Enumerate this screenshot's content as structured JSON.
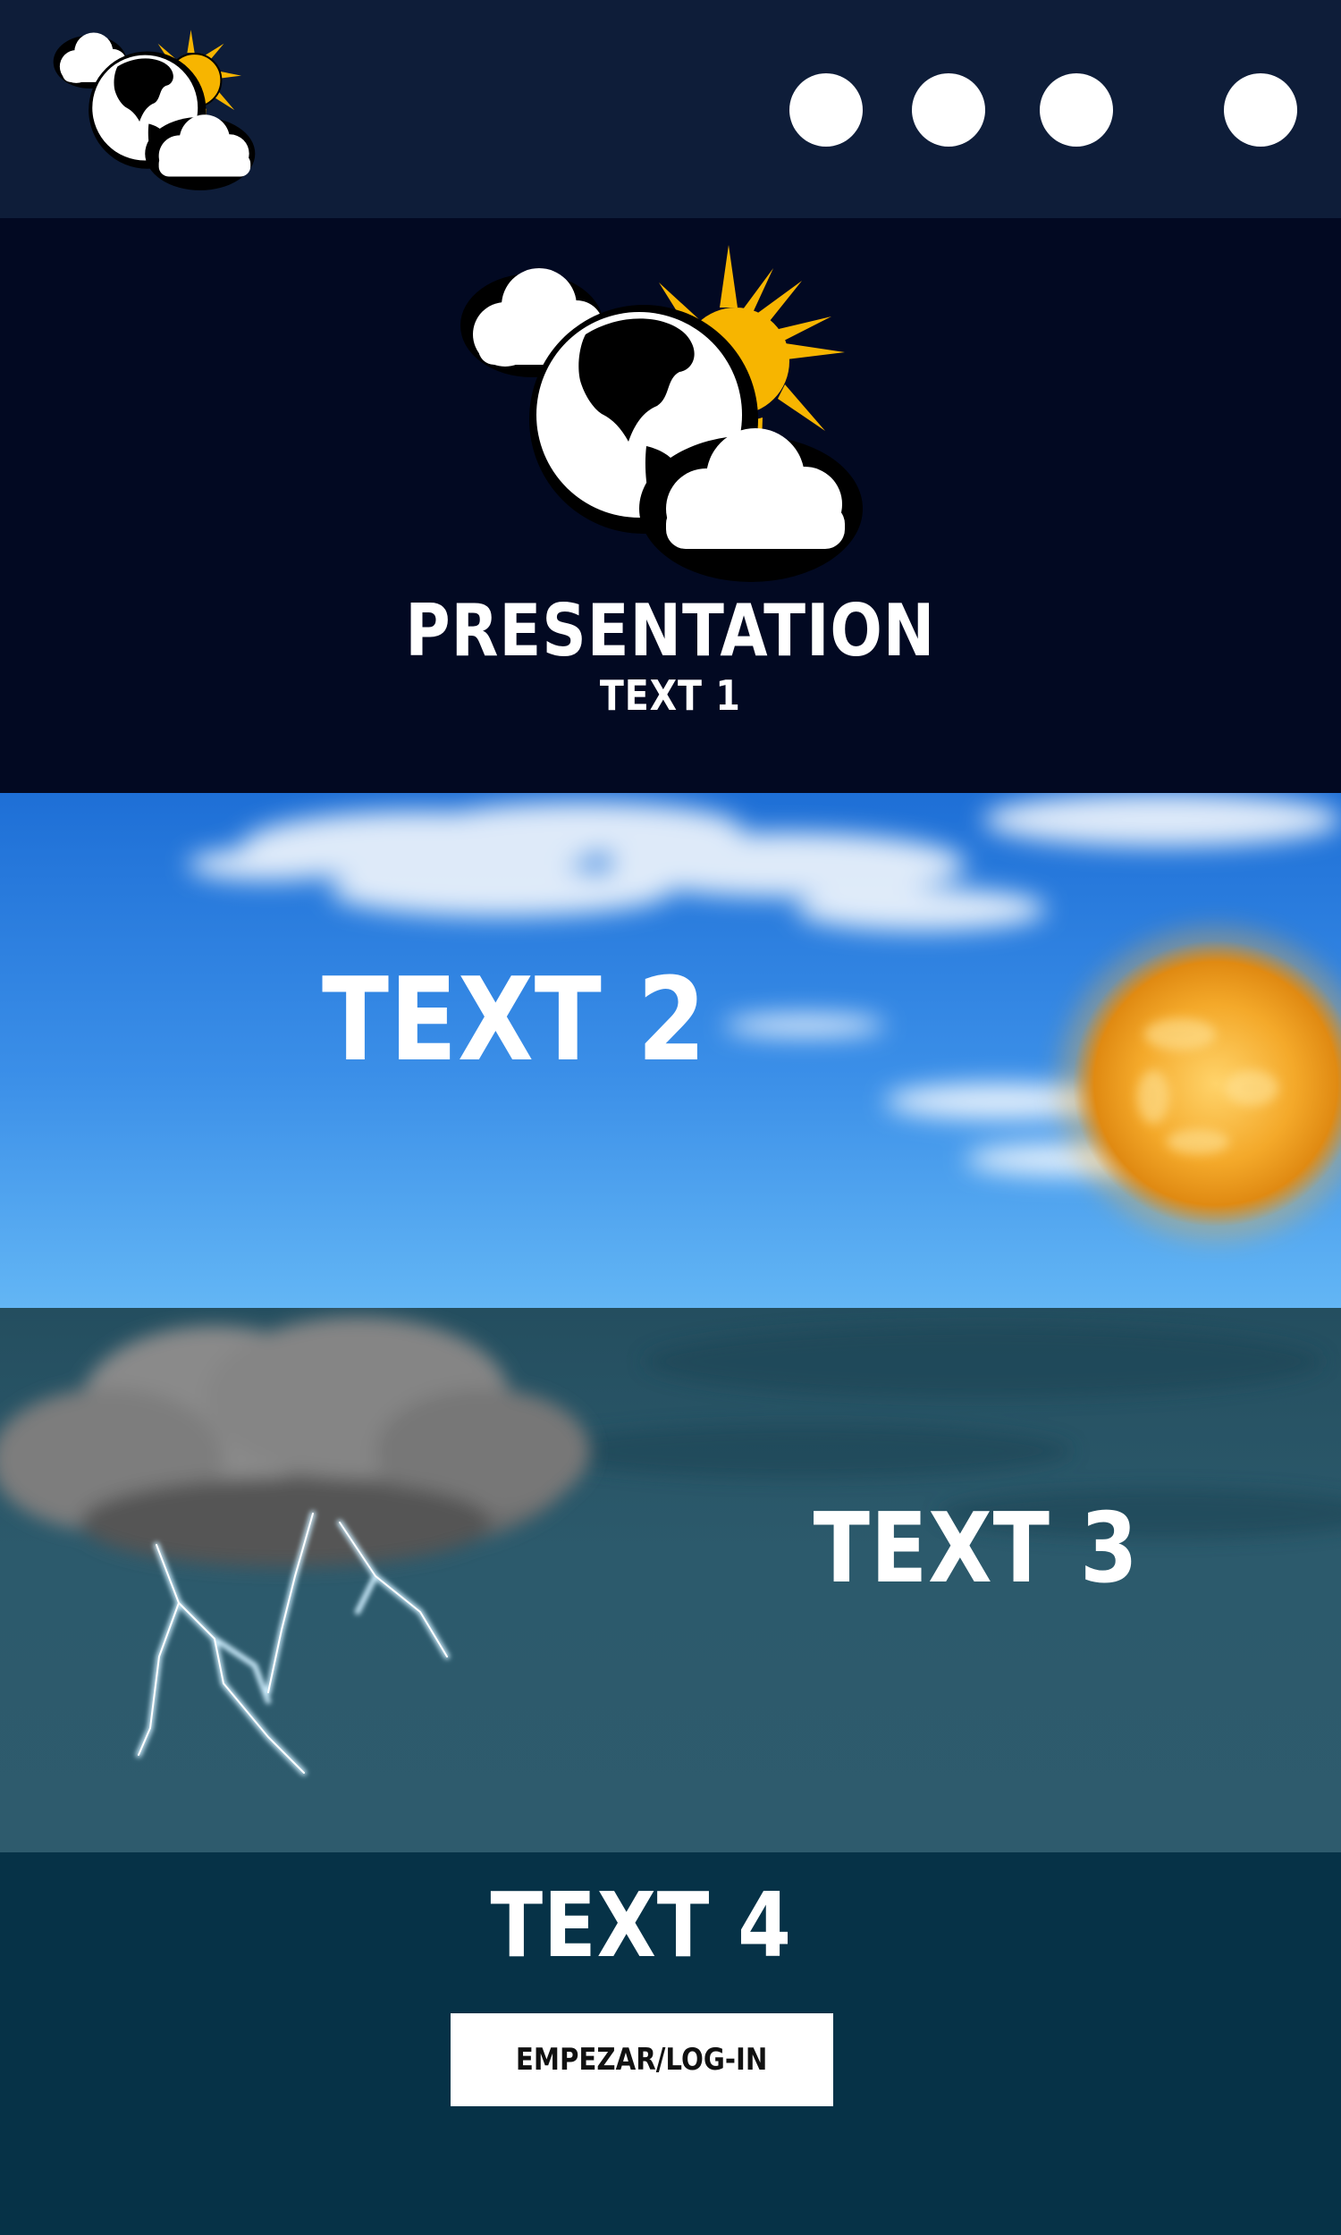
{
  "header": {
    "logo_icon": "globe-sun-clouds-icon",
    "nav_items": [
      "nav-dot-1",
      "nav-dot-2",
      "nav-dot-3",
      "nav-dot-4"
    ]
  },
  "hero": {
    "logo_icon": "globe-sun-clouds-icon",
    "title": "PRESENTATION",
    "subtitle": "TEXT 1"
  },
  "sky_section": {
    "heading": "TEXT 2",
    "decoration_icons": [
      "cloud-icon",
      "sun-icon"
    ]
  },
  "storm_section": {
    "heading": "TEXT 3",
    "decoration_icons": [
      "storm-cloud-icon",
      "lightning-icon"
    ]
  },
  "cta_section": {
    "heading": "TEXT 4",
    "button_label": "EMPEZAR/LOG-IN"
  },
  "colors": {
    "header_bg": "#0e1d39",
    "hero_bg": "#020922",
    "sky_bg": "#3b8fe8",
    "storm_bg": "#2c5a6c",
    "cta_bg": "#063247",
    "sun": "#f7b500",
    "text": "#ffffff"
  }
}
